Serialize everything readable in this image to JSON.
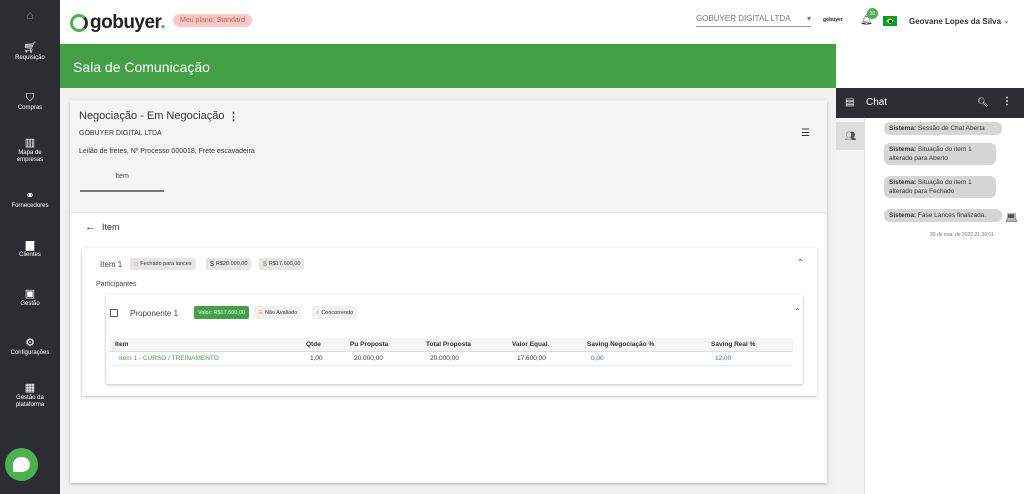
{
  "sidebar": {
    "items": [
      {
        "label": "Requisição",
        "icon": "cart-icon"
      },
      {
        "label": "Compras",
        "icon": "basket-icon"
      },
      {
        "label": "Mapa de empresas",
        "icon": "map-icon"
      },
      {
        "label": "Fornecedores",
        "icon": "handshake-icon"
      },
      {
        "label": "Clientes",
        "icon": "building-icon"
      },
      {
        "label": "Gestão",
        "icon": "chart-icon"
      },
      {
        "label": "Configurações",
        "icon": "gear-icon"
      },
      {
        "label": "Gestão da plataforma",
        "icon": "platform-icon"
      }
    ]
  },
  "header": {
    "logo_text": "gobuyer",
    "plan_badge": "Meu plano: Standard",
    "company": "GOBUYER DIGITAL LTDA",
    "mini_logo": "gobuyer",
    "notifications": "20",
    "user_name": "Geovane Lopes da Silva"
  },
  "banner": {
    "title": "Sala de Comunicação"
  },
  "negotiation": {
    "title": "Negociação - Em Negociação",
    "company": "GOBUYER DIGITAL LTDA",
    "description": "Leilão de fretes, Nº Processo 000018, Frete escavadeira",
    "tab": "Item",
    "back_label": "Item"
  },
  "item": {
    "label": "Item 1",
    "chips": [
      "Fechado para lances",
      "R$20.000,00",
      "R$17.600,00"
    ],
    "participants_label": "Participantes"
  },
  "proponent": {
    "label": "Proponente 1",
    "value_chip": "Valor: R$17.600,00",
    "status_chip": "Não Avaliado",
    "competing_chip": "Concorrendo"
  },
  "table": {
    "headers": [
      "Item",
      "Qtde",
      "Pu Proposta",
      "Total Proposta",
      "Valor Equal.",
      "Saving Negociação %",
      "Saving Real %"
    ],
    "rows": [
      [
        "Item 1 - CURSO / TREINAMENTO",
        "1,00",
        "20.000,00",
        "20.000,00",
        "17.600,00",
        "0,00",
        "12,00"
      ]
    ]
  },
  "chat": {
    "title": "Chat",
    "messages": [
      {
        "sender": "Sistema:",
        "text": "Sessão de Chat Aberta"
      },
      {
        "sender": "Sistema:",
        "text": "Situação do item 1 alterado para Aberto"
      },
      {
        "sender": "Sistema:",
        "text": "Situação do item 1 alterado para Fechado"
      },
      {
        "sender": "Sistema:",
        "text": "Fase Lances finalizada."
      }
    ],
    "timestamp": "30 de mar. de 2022 21:30:01"
  },
  "colors": {
    "brand_green": "#43a047",
    "sidebar_bg": "#2b2d33",
    "plan_badge_bg": "#f7c9c9"
  }
}
